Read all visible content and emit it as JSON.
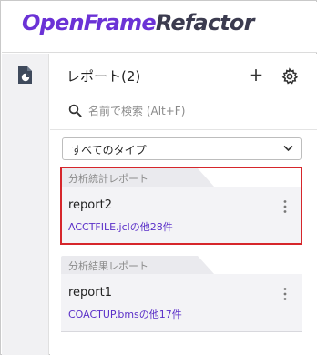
{
  "app": {
    "brand_part1": "OpenFrame",
    "brand_part2": "Refactor"
  },
  "sidebar": {
    "icon": "report-document-icon"
  },
  "panel": {
    "title": "レポート(2)",
    "add_label": "+",
    "search_placeholder": "名前で検索 (Alt+F)",
    "filter_value": "すべてのタイプ"
  },
  "reports": [
    {
      "category": "分析統計レポート",
      "name": "report2",
      "files": "ACCTFILE.jclの他28件",
      "selected": true
    },
    {
      "category": "分析結果レポート",
      "name": "report1",
      "files": "COACTUP.bmsの他17件",
      "selected": false
    }
  ],
  "colors": {
    "brand_accent": "#6b32d6",
    "link": "#5a2fc8",
    "highlight": "#d6262b"
  }
}
